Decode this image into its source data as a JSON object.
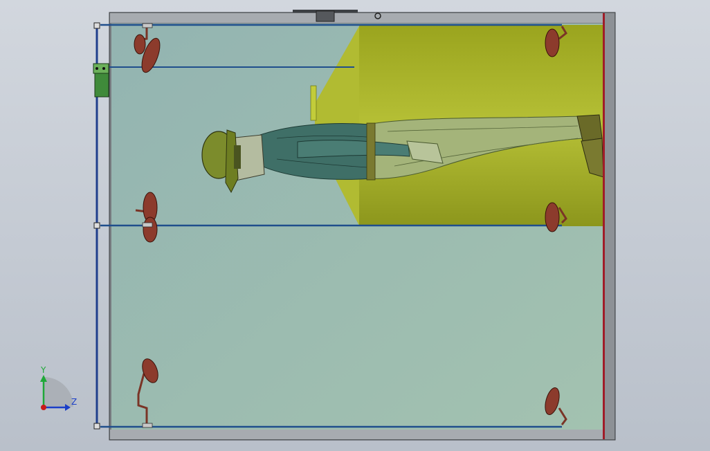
{
  "viewport": {
    "background_top": "#d2d7de",
    "background_bottom": "#b9c0ca"
  },
  "colors": {
    "frame": "#6f7378",
    "frame_light": "#9fa3a8",
    "glass": "#9ebdb3",
    "hopper": "#a4ae2a",
    "hopper_dark": "#6d7a18",
    "rail": "#1f4e8c",
    "red_edge": "#a01c28",
    "nozzle": "#8a3a2a",
    "motor": "#3f8a3a",
    "suit": "#3a6a62",
    "pants": "#9aaa6a",
    "helmet": "#7a8a2a",
    "boot": "#5a5a20"
  },
  "icons": {
    "sprinkler_nozzles": "sprinkler-nozzle-icon",
    "motor": "motor-icon",
    "hinge": "hinge-icon",
    "bolt": "bolt-icon"
  },
  "triad": {
    "y_label": "Y",
    "z_label": "Z",
    "y_color": "#1fa838",
    "z_color": "#1a3ec8",
    "origin_color": "#c81a1a"
  }
}
